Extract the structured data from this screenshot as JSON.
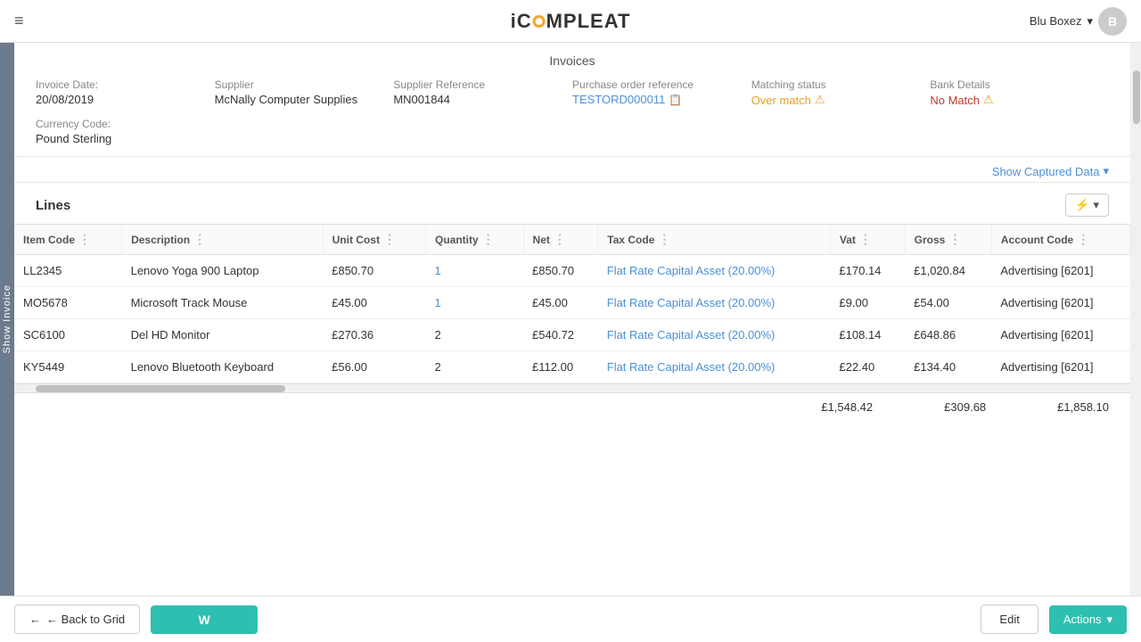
{
  "nav": {
    "hamburger_icon": "≡",
    "brand_text_pre": "iC",
    "brand_text_post": "MPLEAT",
    "user_name": "Blu Boxez",
    "user_dropdown": "▾",
    "avatar_label": "B"
  },
  "breadcrumb": "Invoices",
  "side_label": "Show Invoice",
  "invoice": {
    "invoice_date_label": "Invoice Date:",
    "invoice_date_value": "20/08/2019",
    "supplier_label": "Supplier",
    "supplier_value": "McNally Computer Supplies",
    "supplier_ref_label": "Supplier Reference",
    "supplier_ref_value": "MN001844",
    "po_ref_label": "Purchase order reference",
    "po_ref_value": "TESTORD000011",
    "matching_label": "Matching status",
    "matching_value": "Over match",
    "bank_label": "Bank Details",
    "bank_value": "No Match",
    "currency_label": "Currency Code:",
    "currency_value": "Pound Sterling"
  },
  "show_captured": {
    "label": "Show Captured Data",
    "chevron": "▾"
  },
  "lines": {
    "title": "Lines",
    "columns": [
      "Item Code",
      "Description",
      "Unit Cost",
      "Quantity",
      "Net",
      "Tax Code",
      "Vat",
      "Gross",
      "Account Code"
    ],
    "rows": [
      {
        "item_code": "LL2345",
        "description": "Lenovo Yoga 900 Laptop",
        "unit_cost": "£850.70",
        "quantity": "1",
        "net": "£850.70",
        "tax_code": "Flat Rate Capital Asset (20.00%)",
        "vat": "£170.14",
        "gross": "£1,020.84",
        "account_code": "Advertising [6201]"
      },
      {
        "item_code": "MO5678",
        "description": "Microsoft Track Mouse",
        "unit_cost": "£45.00",
        "quantity": "1",
        "net": "£45.00",
        "tax_code": "Flat Rate Capital Asset (20.00%)",
        "vat": "£9.00",
        "gross": "£54.00",
        "account_code": "Advertising [6201]"
      },
      {
        "item_code": "SC6100",
        "description": "Del HD Monitor",
        "unit_cost": "£270.36",
        "quantity": "2",
        "net": "£540.72",
        "tax_code": "Flat Rate Capital Asset (20.00%)",
        "vat": "£108.14",
        "gross": "£648.86",
        "account_code": "Advertising [6201]"
      },
      {
        "item_code": "KY5449",
        "description": "Lenovo Bluetooth Keyboard",
        "unit_cost": "£56.00",
        "quantity": "2",
        "net": "£112.00",
        "tax_code": "Flat Rate Capital Asset (20.00%)",
        "vat": "£22.40",
        "gross": "£134.40",
        "account_code": "Advertising [6201]"
      }
    ],
    "totals": {
      "net": "£1,548.42",
      "vat": "£309.68",
      "gross": "£1,858.10"
    }
  },
  "footer": {
    "back_label": "← Back to Grid",
    "w_label": "W",
    "edit_label": "Edit",
    "actions_label": "Actions",
    "actions_chevron": "▾"
  }
}
